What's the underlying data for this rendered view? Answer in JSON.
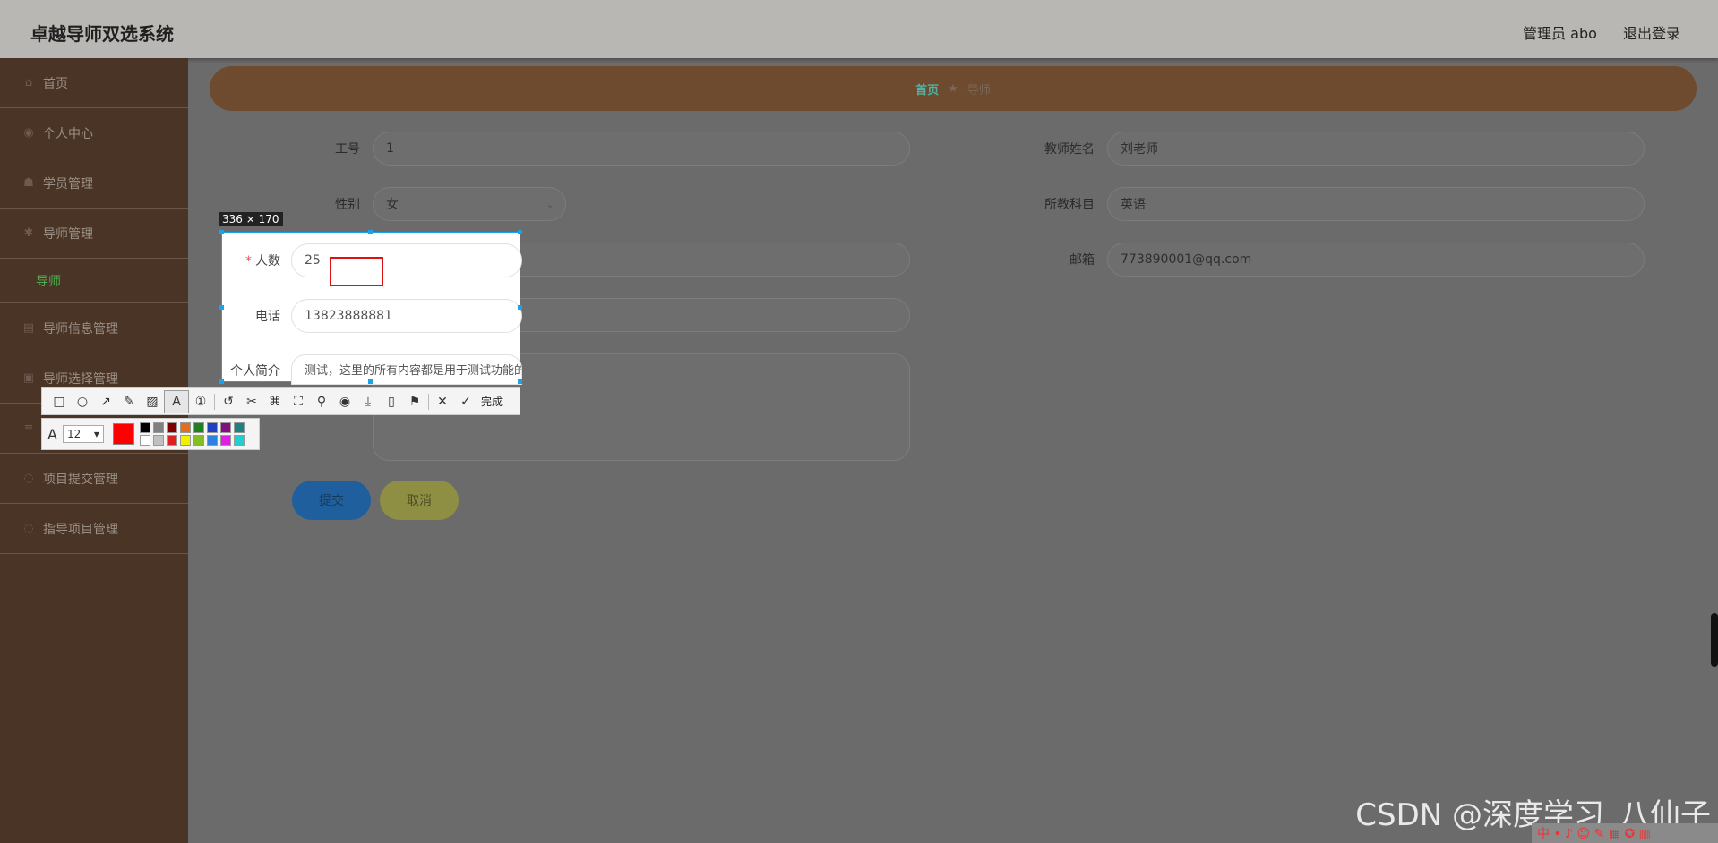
{
  "app": {
    "title": "卓越导师双选系统"
  },
  "header": {
    "user_label": "管理员 abo",
    "logout_label": "退出登录"
  },
  "sidebar": {
    "items": [
      {
        "label": "首页",
        "icon": "home-icon"
      },
      {
        "label": "个人中心",
        "icon": "user-icon"
      },
      {
        "label": "学员管理",
        "icon": "users-icon"
      },
      {
        "label": "导师管理",
        "icon": "teacher-icon"
      },
      {
        "label": "导师信息管理",
        "icon": "info-icon"
      },
      {
        "label": "导师选择管理",
        "icon": "select-icon"
      },
      {
        "label": "",
        "icon": "list-icon"
      },
      {
        "label": "项目提交管理",
        "icon": "upload-icon"
      },
      {
        "label": "指导项目管理",
        "icon": "project-icon"
      }
    ],
    "submenu_label": "导师"
  },
  "breadcrumb": {
    "home": "首页",
    "sep": "★",
    "current": "导师"
  },
  "form": {
    "job_no": {
      "label": "工号",
      "value": "1"
    },
    "teacher_name": {
      "label": "教师姓名",
      "value": "刘老师"
    },
    "gender": {
      "label": "性别",
      "value": "女"
    },
    "subject": {
      "label": "所教科目",
      "value": "英语"
    },
    "count": {
      "label": "人数",
      "value": "25"
    },
    "email": {
      "label": "邮箱",
      "value": "773890001@qq.com"
    },
    "phone": {
      "label": "电话",
      "value": "13823888881"
    },
    "intro": {
      "label": "个人简介",
      "value": "测试，这里的所有内容都是用于测试功能的， 都是可以自行添加修改删除、替换的"
    },
    "submit_label": "提交",
    "cancel_label": "取消"
  },
  "screenshot_tool": {
    "size_tag": "336 × 170",
    "done_label": "完成",
    "font_size": "12",
    "current_color": "#ff0000",
    "palette": [
      "#000000",
      "#808080",
      "#800000",
      "#e07020",
      "#208020",
      "#2040c0",
      "#801080",
      "#208080",
      "#ffffff",
      "#c0c0c0",
      "#e02020",
      "#f0f000",
      "#80c020",
      "#3080e0",
      "#e020e0",
      "#20d0d0"
    ]
  },
  "watermark": "CSDN @深度学习_八仙子",
  "tray_text": "中 • ♪ ☺ ✎ ▦ ✪ ▥"
}
